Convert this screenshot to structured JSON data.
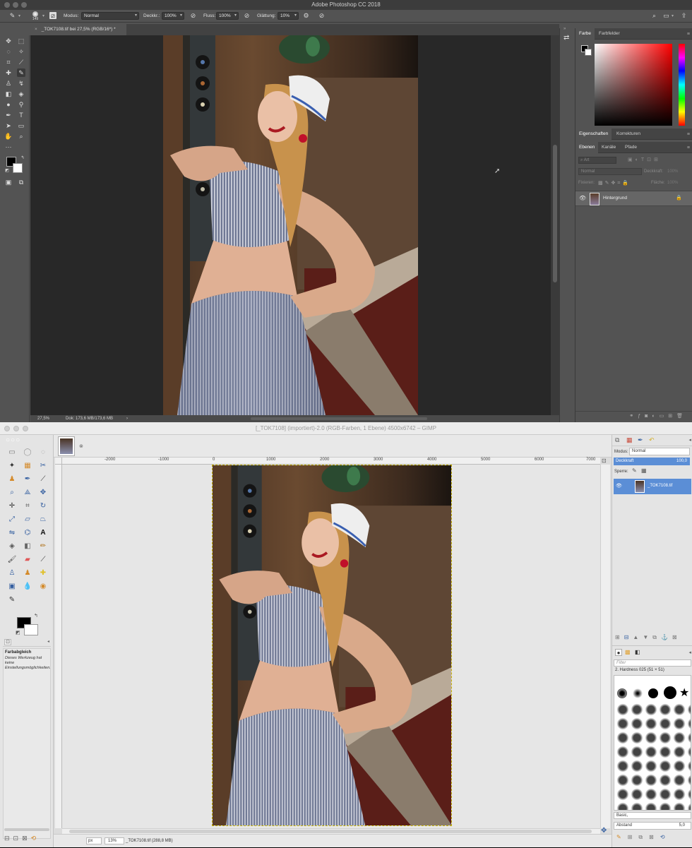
{
  "photoshop": {
    "window_title": "Adobe Photoshop CC 2018",
    "brush_size": "149",
    "options": {
      "mode_label": "Modus:",
      "mode_value": "Normal",
      "opacity_label": "Deckkr.:",
      "opacity_value": "100%",
      "flow_label": "Fluss:",
      "flow_value": "100%",
      "smoothing_label": "Glättung:",
      "smoothing_value": "10%"
    },
    "document_tab": "_TOK7108.tif bei 27,5% (RGB/16*) *",
    "status": {
      "zoom": "27,5%",
      "doc_size": "Dok: 173,6 MB/173,6 MB",
      "arrow": "›"
    },
    "color_panel": {
      "tab_color": "Farbe",
      "tab_swatches": "Farbfelder"
    },
    "properties_panel": {
      "tab_properties": "Eigenschaften",
      "tab_adjustments": "Korrekturen"
    },
    "layers_panel": {
      "tab_layers": "Ebenen",
      "tab_channels": "Kanäle",
      "tab_paths": "Pfade",
      "search_placeholder": "Art",
      "blend_mode": "Normal",
      "opacity_label": "Deckkraft:",
      "opacity_value": "100%",
      "lock_label": "Fixieren:",
      "fill_label": "Fläche:",
      "fill_value": "100%",
      "layer_name": "Hintergrund"
    },
    "footer_icons": [
      "link-icon",
      "fx-icon",
      "mask-icon",
      "adjustment-icon",
      "group-icon",
      "new-layer-icon",
      "trash-icon"
    ]
  },
  "gimp": {
    "window_title": "[_TOK7108] (importiert)-2.0 (RGB-Farben, 1 Ebene) 4500x6742 – GIMP",
    "ruler_ticks": [
      "-2000",
      "-1000",
      "0",
      "1000",
      "2000",
      "3000",
      "4000",
      "5000",
      "6000",
      "7000"
    ],
    "tool_options": {
      "title": "Farbabgleich",
      "description": "Dieses Werkzeug hat keine Einstellungsmöglichkeiten."
    },
    "status": {
      "unit": "px",
      "zoom": "13%",
      "filename": "_TOK7108.tif (288,8 MB)"
    },
    "layers_dock": {
      "mode_label": "Modus:",
      "mode_value": "Normal",
      "opacity_label": "Deckkraft",
      "opacity_value": "100,0",
      "lock_label": "Sperre:",
      "layer_name": "_TOK7108.tif"
    },
    "brushes_dock": {
      "filter_placeholder": "Filter",
      "selected_brush": "2. Hardness 025 (51 × 51)",
      "preset": "Basic,",
      "spacing_label": "Abstand",
      "spacing_value": "5,0"
    }
  },
  "colors": {
    "ps_bg": "#535353",
    "ps_canvas": "#282828",
    "gimp_bg": "#dcdcdc",
    "gimp_selection": "#5b8ed6"
  }
}
